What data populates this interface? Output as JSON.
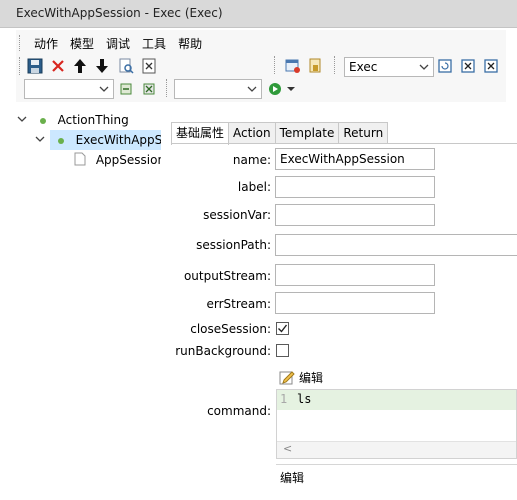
{
  "window": {
    "title": "ExecWithAppSession - Exec (Exec)"
  },
  "menu": [
    "动作",
    "模型",
    "调试",
    "工具",
    "帮助"
  ],
  "toolbar": {
    "combo1_value": "",
    "combo2_value": "",
    "exec_combo_value": "Exec",
    "icons": [
      "save-icon",
      "delete-icon",
      "arrow-up-icon",
      "arrow-down-icon",
      "find-icon",
      "xml-icon",
      "refresh-icon",
      "config-icon",
      "run-icon",
      "dropdown-icon",
      "settings-icon",
      "lock-icon",
      "window-icon",
      "close-window-icon"
    ]
  },
  "tree": {
    "root": "ActionThing",
    "child": "ExecWithAppSession",
    "grandchild": "AppSession"
  },
  "tabs": [
    "基础属性",
    "Action",
    "Template",
    "Return"
  ],
  "form": {
    "name_label": "name:",
    "name_value": "ExecWithAppSession",
    "label_label": "label:",
    "label_value": "",
    "sessionVar_label": "sessionVar:",
    "sessionVar_value": "",
    "sessionPath_label": "sessionPath:",
    "sessionPath_value": "",
    "outputStream_label": "outputStream:",
    "outputStream_value": "",
    "errStream_label": "errStream:",
    "errStream_value": "",
    "closeSession_label": "closeSession:",
    "closeSession_checked": true,
    "runBackground_label": "runBackground:",
    "runBackground_checked": false,
    "command_label": "command:",
    "edit_link": "编辑",
    "command_line_number": "1",
    "command_code": "ls",
    "scroll_left": "<",
    "edit_bottom": "编辑"
  }
}
